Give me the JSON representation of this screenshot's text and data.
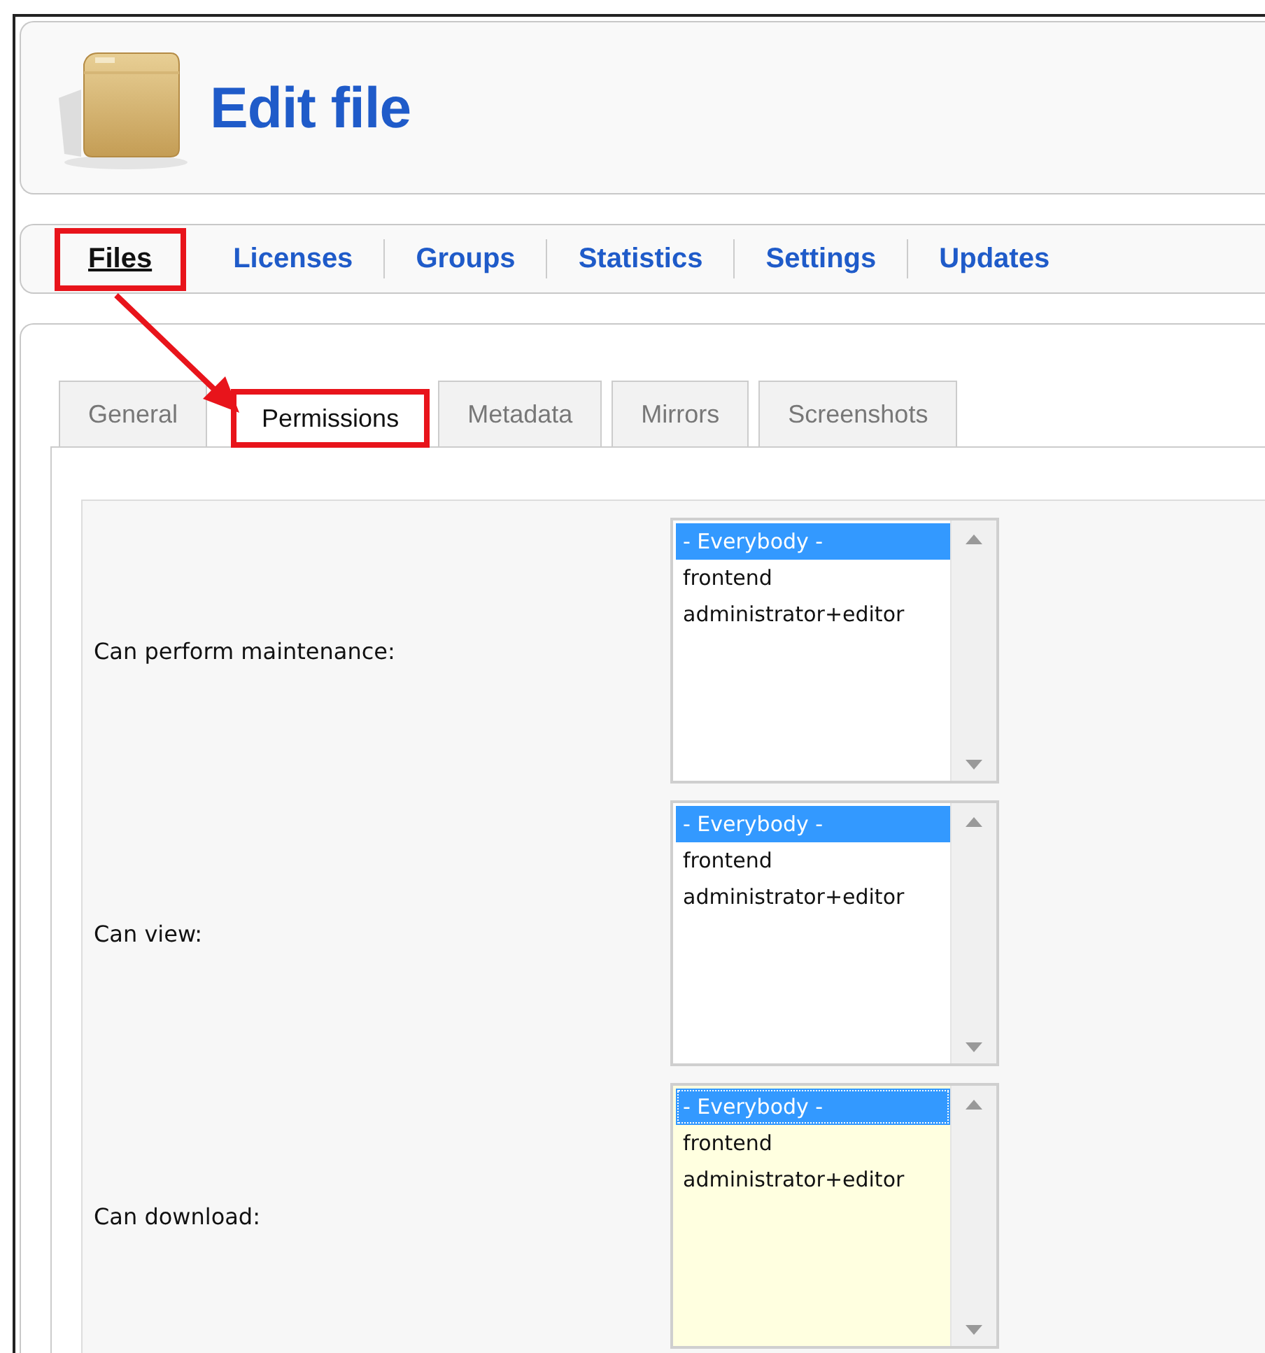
{
  "header": {
    "title": "Edit file"
  },
  "menu": [
    {
      "label": "Files",
      "selected": true,
      "highlighted": true
    },
    {
      "label": "Licenses",
      "selected": false,
      "highlighted": false
    },
    {
      "label": "Groups",
      "selected": false,
      "highlighted": false
    },
    {
      "label": "Statistics",
      "selected": false,
      "highlighted": false
    },
    {
      "label": "Settings",
      "selected": false,
      "highlighted": false
    },
    {
      "label": "Updates",
      "selected": false,
      "highlighted": false
    }
  ],
  "tabs": [
    {
      "label": "General",
      "selected": false,
      "highlighted": false
    },
    {
      "label": "Permissions",
      "selected": true,
      "highlighted": true
    },
    {
      "label": "Metadata",
      "selected": false,
      "highlighted": false
    },
    {
      "label": "Mirrors",
      "selected": false,
      "highlighted": false
    },
    {
      "label": "Screenshots",
      "selected": false,
      "highlighted": false
    }
  ],
  "permissions": [
    {
      "label": "Can perform maintenance:",
      "focused": false,
      "options": [
        {
          "text": "- Everybody -",
          "selected": true
        },
        {
          "text": "frontend",
          "selected": false
        },
        {
          "text": "administrator+editor",
          "selected": false
        }
      ]
    },
    {
      "label": "Can view:",
      "focused": false,
      "options": [
        {
          "text": "- Everybody -",
          "selected": true
        },
        {
          "text": "frontend",
          "selected": false
        },
        {
          "text": "administrator+editor",
          "selected": false
        }
      ]
    },
    {
      "label": "Can download:",
      "focused": true,
      "options": [
        {
          "text": "- Everybody -",
          "selected": true
        },
        {
          "text": "frontend",
          "selected": false
        },
        {
          "text": "administrator+editor",
          "selected": false
        }
      ]
    }
  ]
}
